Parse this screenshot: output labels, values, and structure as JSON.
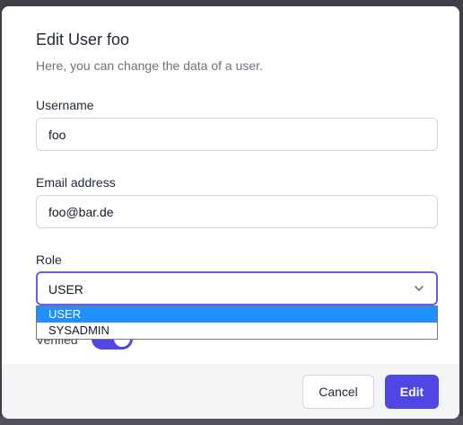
{
  "modal": {
    "title": "Edit User foo",
    "subtitle": "Here, you can change the data of a user."
  },
  "fields": {
    "username": {
      "label": "Username",
      "value": "foo"
    },
    "email": {
      "label": "Email address",
      "value": "foo@bar.de"
    },
    "role": {
      "label": "Role",
      "value": "USER",
      "options": [
        "USER",
        "SYSADMIN"
      ],
      "highlighted_option": "USER"
    },
    "verified": {
      "label": "Verified",
      "checked": true
    }
  },
  "footer": {
    "cancel_label": "Cancel",
    "edit_label": "Edit"
  },
  "colors": {
    "accent": "#4f46e5",
    "focus_border": "#6d5ce7",
    "option_highlight": "#1e90ff"
  },
  "icons": {
    "select_chevron": "chevron-down-icon"
  }
}
